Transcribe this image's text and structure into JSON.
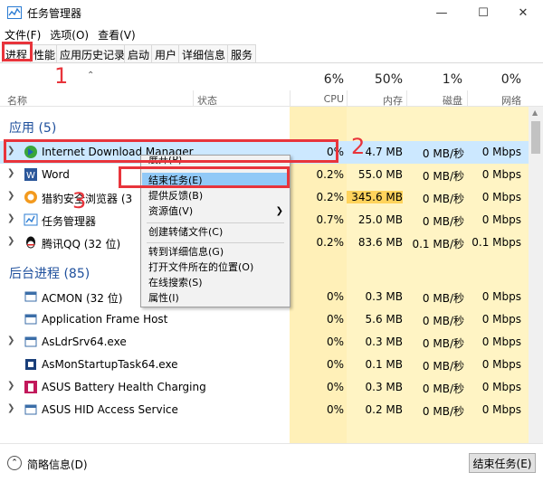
{
  "window": {
    "title": "任务管理器"
  },
  "menu": [
    {
      "label": "文件(F)"
    },
    {
      "label": "选项(O)"
    },
    {
      "label": "查看(V)"
    }
  ],
  "tabs": [
    {
      "label": "进程",
      "active": true
    },
    {
      "label": "性能"
    },
    {
      "label": "应用历史记录"
    },
    {
      "label": "启动"
    },
    {
      "label": "用户"
    },
    {
      "label": "详细信息"
    },
    {
      "label": "服务"
    }
  ],
  "columns": {
    "name": "名称",
    "status": "状态",
    "cpu": {
      "pct": "6%",
      "label": "CPU"
    },
    "mem": {
      "pct": "50%",
      "label": "内存"
    },
    "disk": {
      "pct": "1%",
      "label": "磁盘"
    },
    "net": {
      "pct": "0%",
      "label": "网络"
    }
  },
  "groups": {
    "apps": "应用 (5)",
    "background": "后台进程 (85)"
  },
  "apps": [
    {
      "name": "Internet Download Manager",
      "cpu": "0%",
      "mem": "4.7 MB",
      "disk": "0 MB/秒",
      "net": "0 Mbps",
      "icon": "idm-icon"
    },
    {
      "name": "Word",
      "cpu": "0.2%",
      "mem": "55.0 MB",
      "disk": "0 MB/秒",
      "net": "0 Mbps",
      "icon": "word-icon"
    },
    {
      "name": "猎豹安全浏览器 (3",
      "cpu": "0.2%",
      "mem": "345.6 MB",
      "disk": "0 MB/秒",
      "net": "0 Mbps",
      "icon": "liebao-icon"
    },
    {
      "name": "任务管理器",
      "cpu": "0.7%",
      "mem": "25.0 MB",
      "disk": "0 MB/秒",
      "net": "0 Mbps",
      "icon": "taskmgr-icon"
    },
    {
      "name": "腾讯QQ (32 位)",
      "cpu": "0.2%",
      "mem": "83.6 MB",
      "disk": "0.1 MB/秒",
      "net": "0.1 Mbps",
      "icon": "qq-icon"
    }
  ],
  "background": [
    {
      "name": "ACMON (32 位)",
      "cpu": "0%",
      "mem": "0.3 MB",
      "disk": "0 MB/秒",
      "net": "0 Mbps"
    },
    {
      "name": "Application Frame Host",
      "cpu": "0%",
      "mem": "5.6 MB",
      "disk": "0 MB/秒",
      "net": "0 Mbps"
    },
    {
      "name": "AsLdrSrv64.exe",
      "cpu": "0%",
      "mem": "0.3 MB",
      "disk": "0 MB/秒",
      "net": "0 Mbps"
    },
    {
      "name": "AsMonStartupTask64.exe",
      "cpu": "0%",
      "mem": "0.1 MB",
      "disk": "0 MB/秒",
      "net": "0 Mbps"
    },
    {
      "name": "ASUS Battery Health Charging",
      "cpu": "0%",
      "mem": "0.3 MB",
      "disk": "0 MB/秒",
      "net": "0 Mbps"
    },
    {
      "name": "ASUS HID Access Service",
      "cpu": "0%",
      "mem": "0.2 MB",
      "disk": "0 MB/秒",
      "net": "0 Mbps"
    }
  ],
  "context_menu": [
    {
      "label": "展开(P)"
    },
    {
      "label": "结束任务(E)",
      "selected": true
    },
    {
      "label": "提供反馈(B)"
    },
    {
      "label": "资源值(V)",
      "submenu": true
    },
    {
      "label": "创建转储文件(C)"
    },
    {
      "label": "转到详细信息(G)"
    },
    {
      "label": "打开文件所在的位置(O)"
    },
    {
      "label": "在线搜索(S)"
    },
    {
      "label": "属性(I)"
    }
  ],
  "footer": {
    "fewer_details": "简略信息(D)",
    "end_task": "结束任务(E)"
  },
  "annotations": [
    "1",
    "2",
    "3"
  ],
  "colors": {
    "annotation": "#e8343b",
    "group_title": "#1e4f9c",
    "highlight": "#cce8ff",
    "menu_selected": "#91c9f7"
  }
}
